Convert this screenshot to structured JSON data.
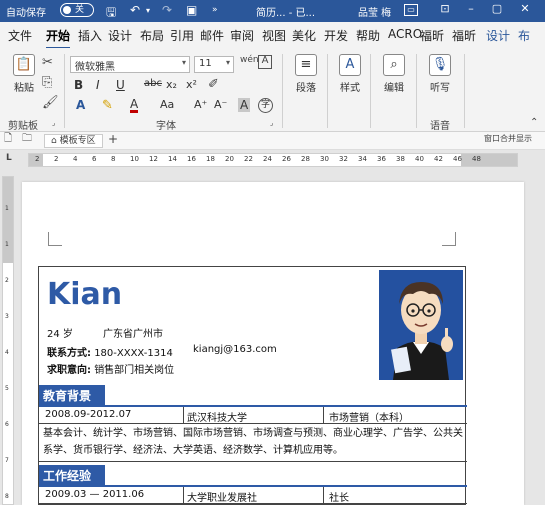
{
  "titlebar": {
    "autosave_label": "自动保存",
    "autosave_state": "关",
    "doc_title": "简历...  -  已...",
    "user": "品莹 梅",
    "colors": {
      "bar": "#2b579a"
    }
  },
  "tabs": [
    "文件",
    "开始",
    "插入",
    "设计",
    "布局",
    "引用",
    "邮件",
    "审阅",
    "视图",
    "美化",
    "开发",
    "帮助",
    "ACRO",
    "福昕",
    "福昕",
    "设计",
    "布"
  ],
  "active_tab": "开始",
  "ribbon": {
    "clipboard": {
      "paste_label": "粘贴",
      "group_label": "剪贴板"
    },
    "font": {
      "font_name": "微软雅黑",
      "font_size": "11",
      "group_label": "字体",
      "buttons": [
        "B",
        "I",
        "U",
        "abc",
        "x₂",
        "x²",
        "A",
        "Aa",
        "A⁺",
        "A⁻",
        "A",
        "字"
      ]
    },
    "paragraph": {
      "label": "段落"
    },
    "styles": {
      "label": "样式"
    },
    "editing": {
      "label": "编辑"
    },
    "voice": {
      "label": "听写",
      "group_label": "语音"
    }
  },
  "tabstrip": {
    "template_tab": "模板专区",
    "add": "+",
    "right_text": "窗口合并显示"
  },
  "ruler": {
    "left_marker": "L",
    "numbers": [
      "2",
      "2",
      "4",
      "6",
      "8",
      "10",
      "12",
      "14",
      "16",
      "18",
      "20",
      "22",
      "24",
      "26",
      "28",
      "30",
      "32",
      "34",
      "36",
      "38",
      "40",
      "42",
      "46",
      "48"
    ]
  },
  "vruler": {
    "numbers": [
      "1",
      "1",
      "2",
      "3",
      "4",
      "5",
      "6",
      "7",
      "8"
    ]
  },
  "resume": {
    "name": "Kian",
    "age": "24 岁",
    "location": "广东省广州市",
    "contact_label": "联系方式:",
    "phone": "180-XXXX-1314",
    "email": "kiangj@163.com",
    "intent_label": "求职意向:",
    "intent": "销售部门相关岗位",
    "education": {
      "header": "教育背景",
      "period": "2008.09-2012.07",
      "school": "武汉科技大学",
      "major": "市场营销（本科）",
      "courses": "基本会计、统计学、市场营销、国际市场营销、市场调查与预测、商业心理学、广告学、公共关系学、货币银行学、经济法、大学英语、经济数学、计算机应用等。"
    },
    "work": {
      "header": "工作经验",
      "period": "2009.03 — 2011.06",
      "org": "大学职业发展社",
      "role": "社长"
    },
    "colors": {
      "accent": "#2e5aa6"
    }
  }
}
